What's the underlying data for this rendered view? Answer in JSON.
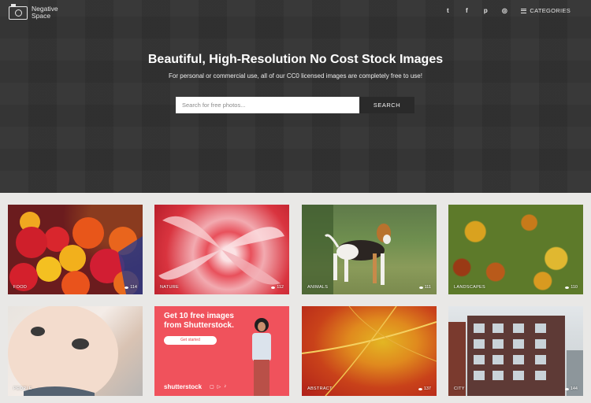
{
  "logo": {
    "line1": "Negative",
    "line2": "Space"
  },
  "nav": {
    "social": [
      {
        "name": "twitter-icon",
        "glyph": "t"
      },
      {
        "name": "facebook-icon",
        "glyph": "f"
      },
      {
        "name": "pinterest-icon",
        "glyph": "p"
      },
      {
        "name": "instagram-icon",
        "glyph": "◎"
      }
    ],
    "categories_label": "CATEGORIES"
  },
  "hero": {
    "title": "Beautiful, High-Resolution No Cost Stock Images",
    "subtitle": "For personal or commercial use, all of our CC0 licensed images are completely free to use!",
    "search_placeholder": "Search for free photos...",
    "search_button": "SEARCH"
  },
  "cards": [
    {
      "label": "FOOD",
      "count": "114"
    },
    {
      "label": "NATURE",
      "count": "112"
    },
    {
      "label": "ANIMALS",
      "count": "111"
    },
    {
      "label": "LANDSCAPES",
      "count": "110"
    },
    {
      "label": "PEOPLE",
      "count": ""
    },
    {
      "label": "ABSTRACT",
      "count": "137"
    },
    {
      "label": "CITY",
      "count": "144"
    }
  ],
  "promo": {
    "title_line1": "Get 10 free images",
    "title_line2": "from Shutterstock.",
    "button": "Get started",
    "brand": "shutterstock"
  }
}
